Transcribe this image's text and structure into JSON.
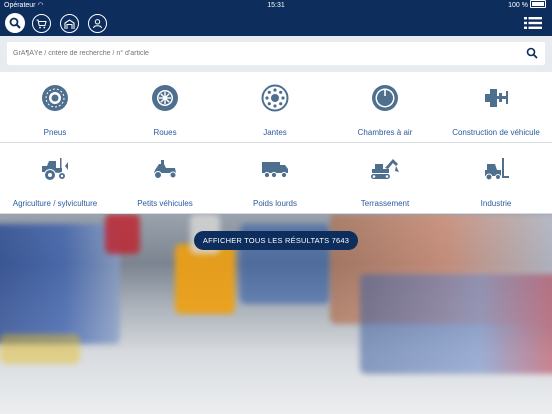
{
  "status": {
    "carrier": "Opérateur",
    "time": "15:31",
    "battery": "100 %"
  },
  "nav": {
    "icons": [
      "search-icon",
      "cart-icon",
      "garage-icon",
      "user-icon",
      "menu-icon"
    ]
  },
  "search": {
    "placeholder": "GrÃ¶ÃŸe / critère de recherche / n° d'article"
  },
  "categories": [
    {
      "label": "Pneus",
      "icon": "tire-icon"
    },
    {
      "label": "Roues",
      "icon": "wheel-icon"
    },
    {
      "label": "Jantes",
      "icon": "rim-icon"
    },
    {
      "label": "Chambres à air",
      "icon": "inner-tube-icon"
    },
    {
      "label": "Construction de véhicule",
      "icon": "vehicle-construction-icon"
    },
    {
      "label": "Agriculture / sylviculture",
      "icon": "tractor-icon"
    },
    {
      "label": "Petits véhicules",
      "icon": "lawnmower-icon"
    },
    {
      "label": "Poids lourds",
      "icon": "truck-icon"
    },
    {
      "label": "Terrassement",
      "icon": "excavator-icon"
    },
    {
      "label": "Industrie",
      "icon": "forklift-icon"
    }
  ],
  "cta": {
    "label": "AFFICHER TOUS LES RÉSULTATS 7643"
  },
  "colors": {
    "navy": "#0d2d5c",
    "icon": "#4f6f8f",
    "label": "#2a5aa0"
  }
}
